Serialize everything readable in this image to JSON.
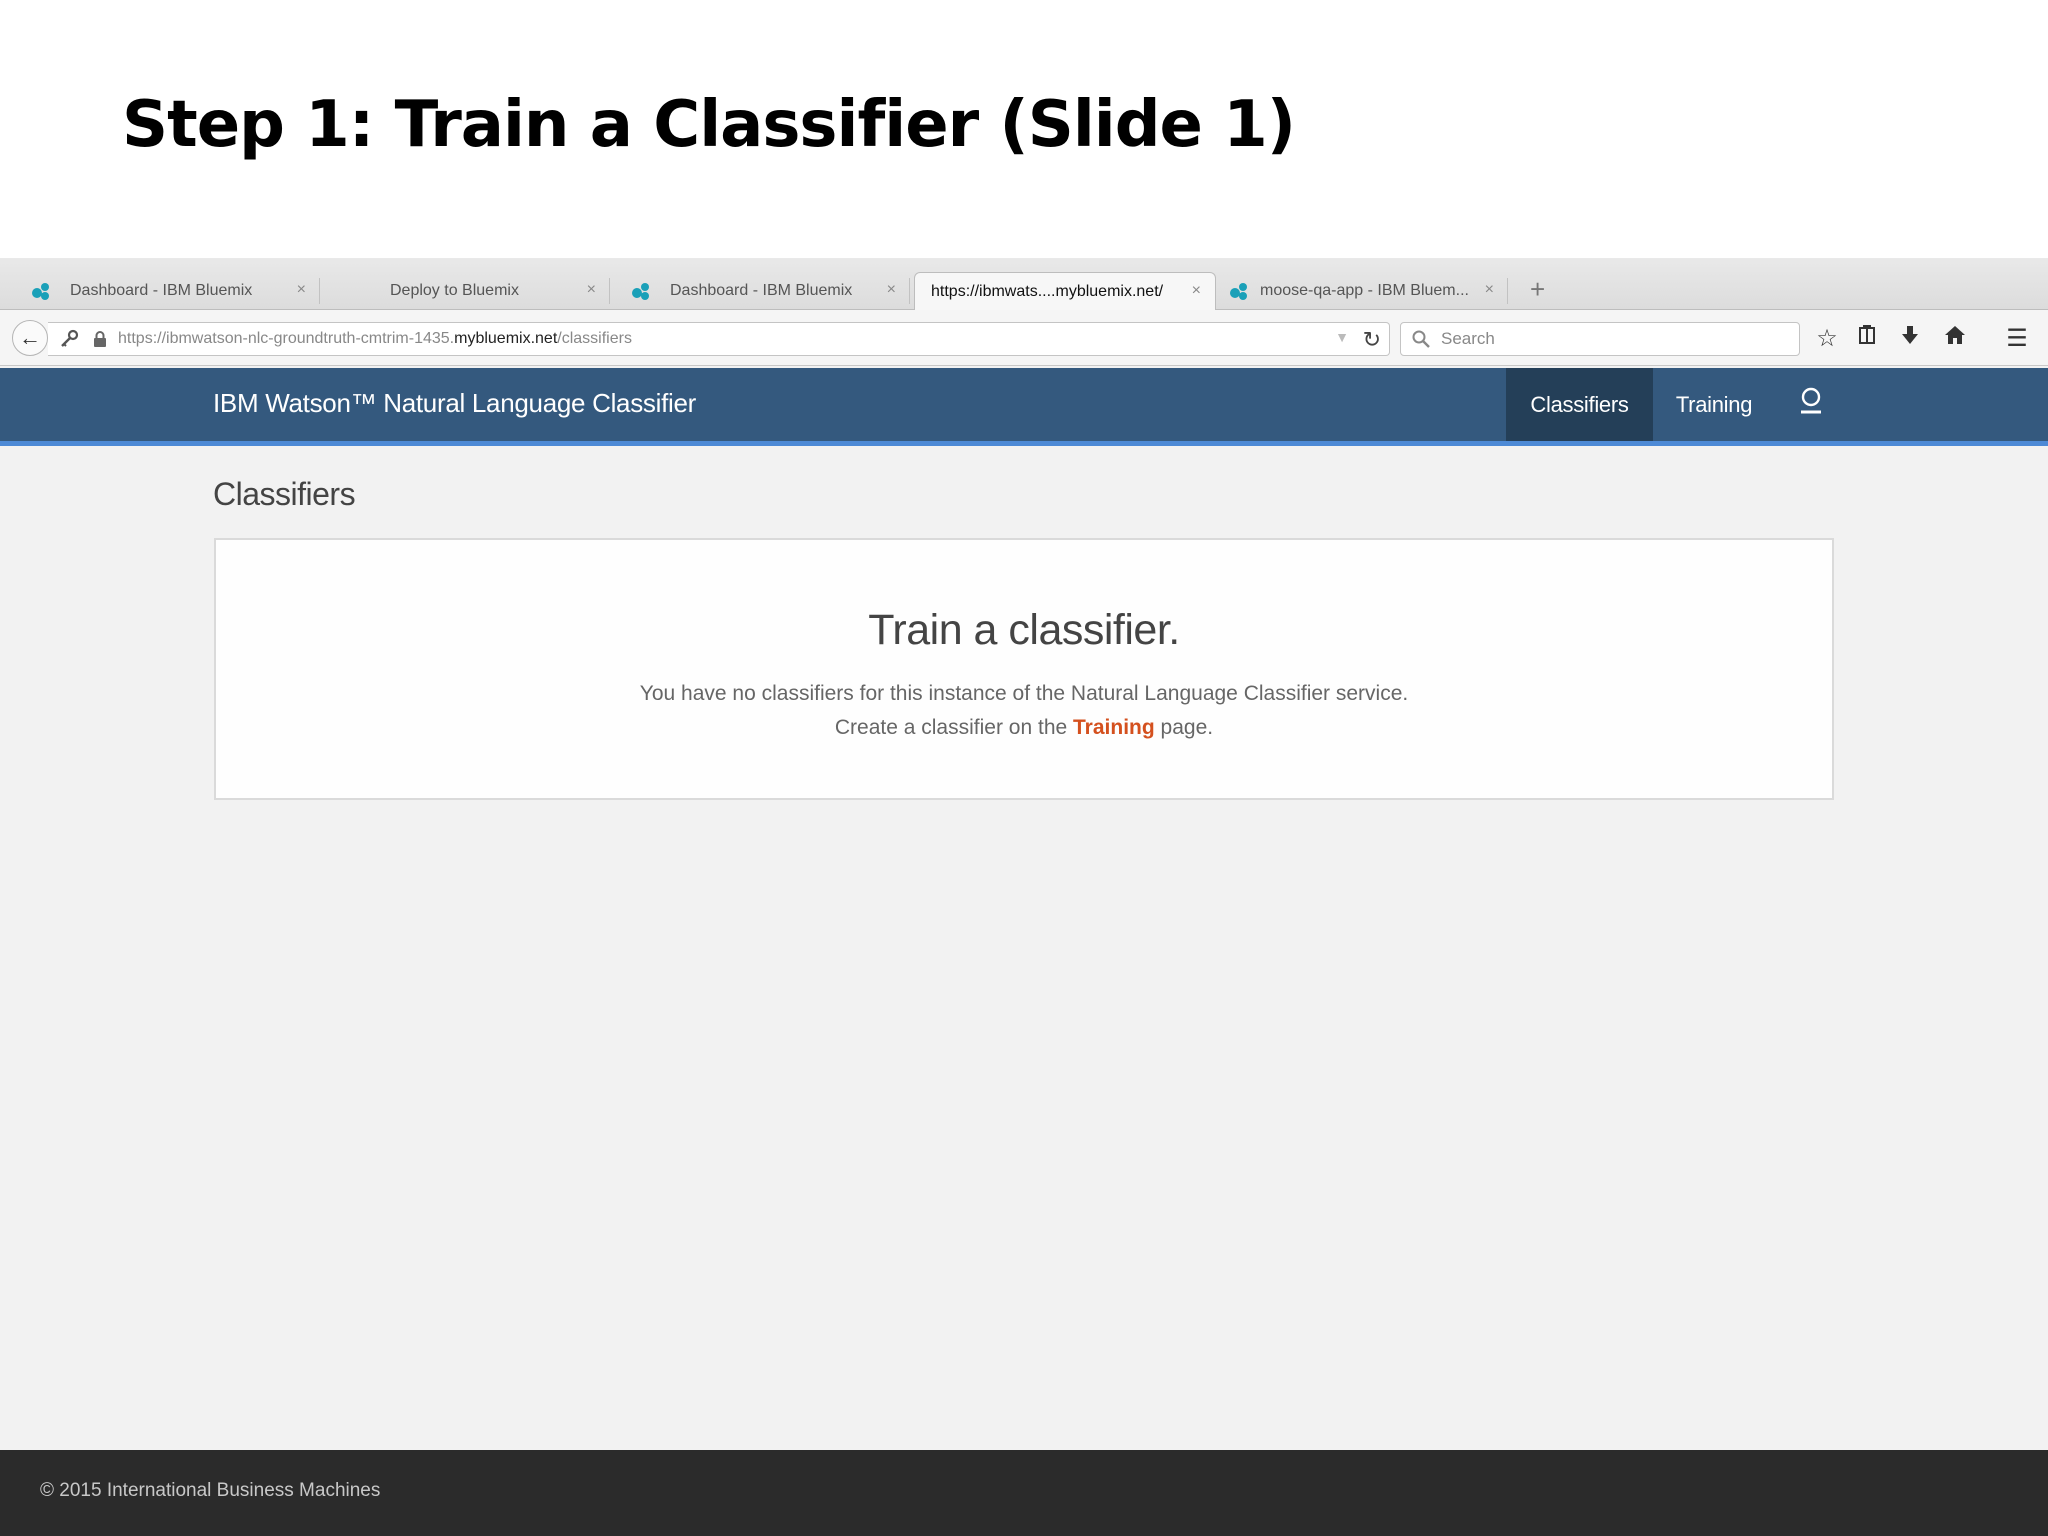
{
  "slide": {
    "title": "Step 1: Train a Classifier (Slide 1)",
    "footer": "© 2015 International Business Machines"
  },
  "browser": {
    "tabs": [
      {
        "label": "Dashboard - IBM Bluemix",
        "has_favicon": true,
        "active": false
      },
      {
        "label": "Deploy to Bluemix",
        "has_favicon": false,
        "active": false
      },
      {
        "label": "Dashboard - IBM Bluemix",
        "has_favicon": true,
        "active": false
      },
      {
        "label": "https://ibmwats....mybluemix.net/",
        "has_favicon": false,
        "active": true
      },
      {
        "label": "moose-qa-app - IBM Bluem...",
        "has_favicon": true,
        "active": false
      }
    ],
    "tab_close_glyph": "×",
    "new_tab_glyph": "+",
    "url": {
      "prefix": "https://ibmwatson-nlc-groundtruth-cmtrim-1435.",
      "host": "mybluemix.net",
      "path": "/classifiers"
    },
    "search_placeholder": "Search",
    "colors": {
      "favicon": "#1aa0b8"
    }
  },
  "app": {
    "title": "IBM Watson™ Natural Language Classifier",
    "nav": [
      {
        "label": "Classifiers",
        "active": true
      },
      {
        "label": "Training",
        "active": false
      }
    ],
    "section_title": "Classifiers",
    "empty_state": {
      "heading": "Train a classifier.",
      "line1": "You have no classifiers for this instance of the Natural Language Classifier service.",
      "line2_before": "Create a classifier on the ",
      "line2_link": "Training",
      "line2_after": " page."
    },
    "colors": {
      "header_bg": "#34597e",
      "nav_active_bg": "#243f58",
      "header_accent": "#4d8ad6",
      "link": "#d4501e"
    }
  }
}
